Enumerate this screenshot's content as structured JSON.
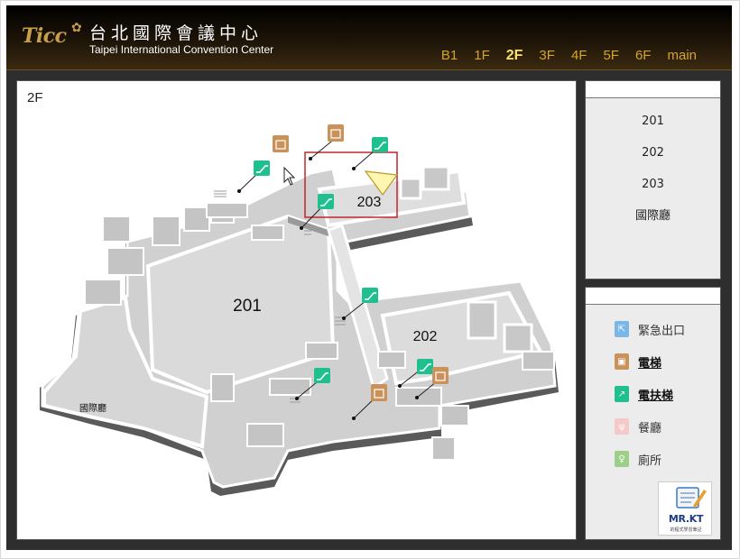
{
  "header": {
    "logo": "Ticc",
    "title_zh": "台北國際會議中心",
    "title_en": "Taipei International Convention Center"
  },
  "floors": [
    {
      "label": "B1",
      "active": false
    },
    {
      "label": "1F",
      "active": false
    },
    {
      "label": "2F",
      "active": true
    },
    {
      "label": "3F",
      "active": false
    },
    {
      "label": "4F",
      "active": false
    },
    {
      "label": "5F",
      "active": false
    },
    {
      "label": "6F",
      "active": false
    },
    {
      "label": "main",
      "active": false
    }
  ],
  "map": {
    "floor_label": "2F",
    "room_labels": {
      "r201": "201",
      "r202": "202",
      "r203": "203",
      "hall": "國際廳"
    }
  },
  "rooms": [
    "201",
    "202",
    "203",
    "國際廳"
  ],
  "legend": [
    {
      "label": "緊急出口",
      "icon": "emergency-exit-icon",
      "color": "#7ab6e8",
      "strong": false
    },
    {
      "label": "電梯",
      "icon": "elevator-icon",
      "color": "#c8925a",
      "strong": true
    },
    {
      "label": "電扶梯",
      "icon": "escalator-icon",
      "color": "#1fbf8f",
      "strong": true
    },
    {
      "label": "餐廳",
      "icon": "restaurant-icon",
      "color": "#f3c9c9",
      "strong": false
    },
    {
      "label": "廁所",
      "icon": "restroom-icon",
      "color": "#9ccf8a",
      "strong": false
    }
  ],
  "badge": {
    "title": "MR.KT",
    "subtitle": "的程式學習筆記"
  },
  "colors": {
    "header_gold": "#d4a52c",
    "active_floor": "#ffe066",
    "highlight_box": "#c0262b",
    "escalator": "#1fbf8f",
    "elevator": "#c8925a"
  }
}
